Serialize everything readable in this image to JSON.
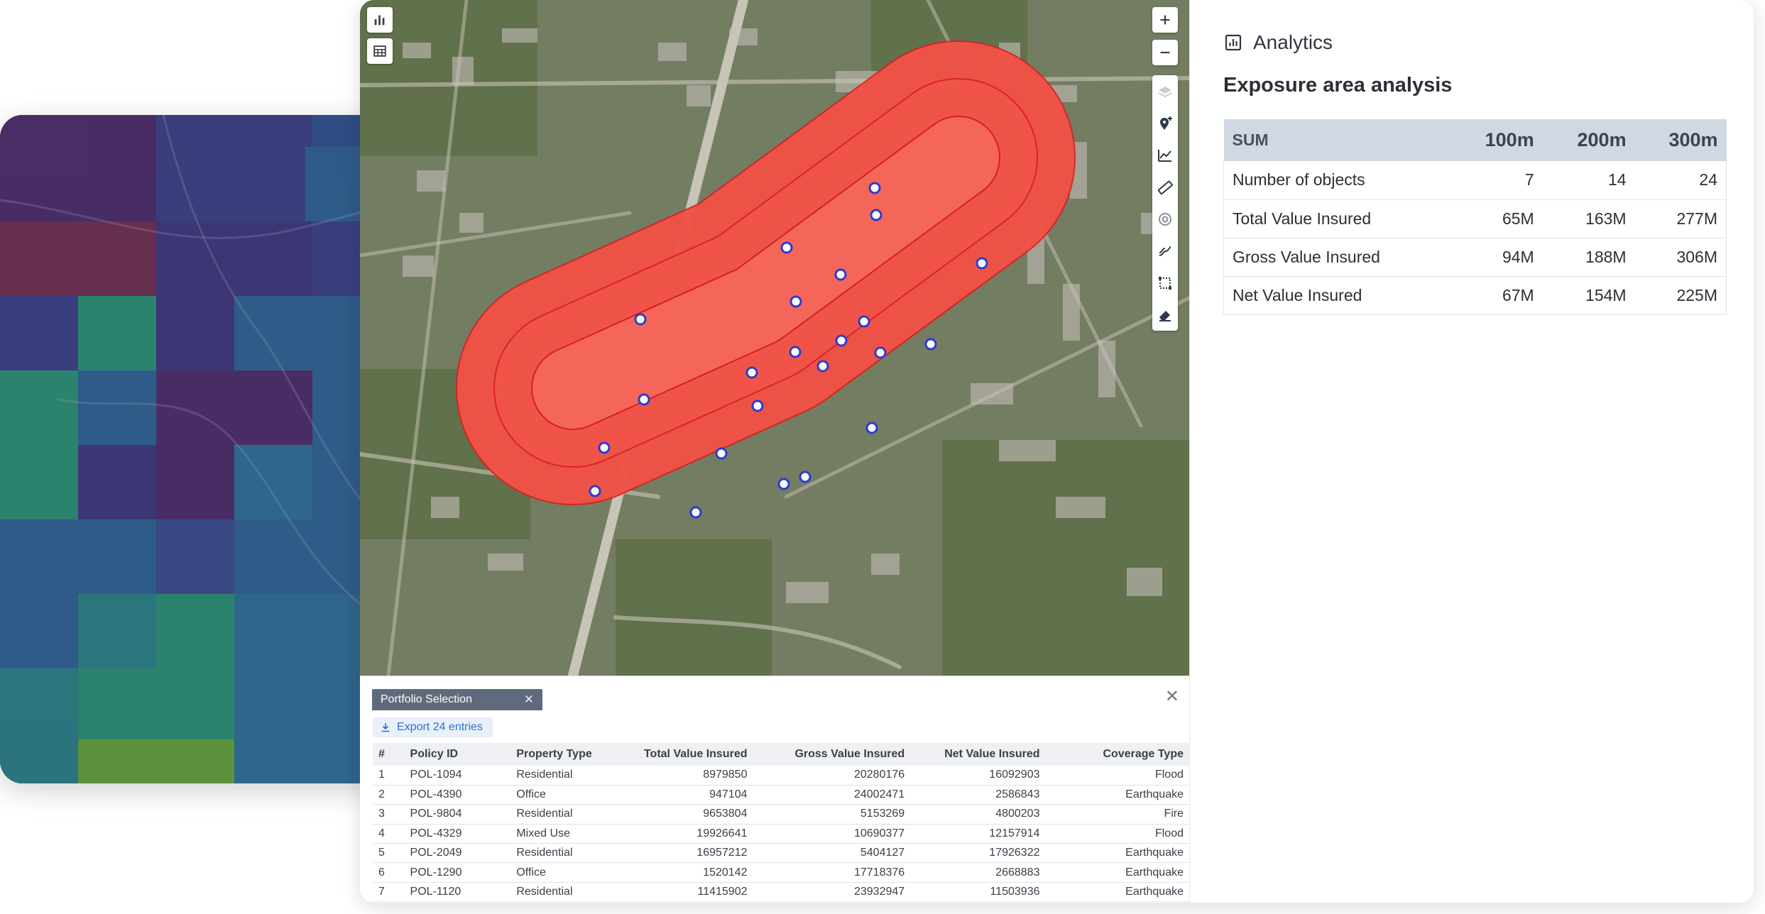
{
  "analytics": {
    "header": "Analytics",
    "title": "Exposure area analysis",
    "table": {
      "headers": [
        "SUM",
        "100m",
        "200m",
        "300m"
      ],
      "rows": [
        {
          "label": "Number of objects",
          "v100": "7",
          "v200": "14",
          "v300": "24"
        },
        {
          "label": "Total Value Insured",
          "v100": "65M",
          "v200": "163M",
          "v300": "277M"
        },
        {
          "label": "Gross Value Insured",
          "v100": "94M",
          "v200": "188M",
          "v300": "306M"
        },
        {
          "label": "Net Value Insured",
          "v100": "67M",
          "v200": "154M",
          "v300": "225M"
        }
      ]
    }
  },
  "panel": {
    "tab_label": "Portfolio Selection",
    "export_label": "Export 24 entries",
    "columns": [
      "#",
      "Policy ID",
      "Property Type",
      "Total Value Insured",
      "Gross Value Insured",
      "Net Value Insured",
      "Coverage Type"
    ],
    "rows": [
      {
        "n": "1",
        "id": "POL-1094",
        "type": "Residential",
        "tvi": "8979850",
        "gvi": "20280176",
        "nvi": "16092903",
        "cov": "Flood"
      },
      {
        "n": "2",
        "id": "POL-4390",
        "type": "Office",
        "tvi": "947104",
        "gvi": "24002471",
        "nvi": "2586843",
        "cov": "Earthquake"
      },
      {
        "n": "3",
        "id": "POL-9804",
        "type": "Residential",
        "tvi": "9653804",
        "gvi": "5153269",
        "nvi": "4800203",
        "cov": "Fire"
      },
      {
        "n": "4",
        "id": "POL-4329",
        "type": "Mixed Use",
        "tvi": "19926641",
        "gvi": "10690377",
        "nvi": "12157914",
        "cov": "Flood"
      },
      {
        "n": "5",
        "id": "POL-2049",
        "type": "Residential",
        "tvi": "16957212",
        "gvi": "5404127",
        "nvi": "17926322",
        "cov": "Earthquake"
      },
      {
        "n": "6",
        "id": "POL-1290",
        "type": "Office",
        "tvi": "1520142",
        "gvi": "17718376",
        "nvi": "2668883",
        "cov": "Earthquake"
      },
      {
        "n": "7",
        "id": "POL-1120",
        "type": "Residential",
        "tvi": "11415902",
        "gvi": "23932947",
        "nvi": "11503936",
        "cov": "Earthquake"
      }
    ]
  },
  "map_tools": {
    "left": [
      "bar-chart-icon",
      "table-icon"
    ],
    "zoom": [
      "zoom-in-icon",
      "zoom-out-icon"
    ],
    "column": [
      "layers-icon",
      "marker-add-icon",
      "line-chart-icon",
      "ruler-icon",
      "target-icon",
      "route-icon",
      "select-rect-icon",
      "eraser-icon"
    ]
  },
  "colors": {
    "buffer_fill": "#f0473f",
    "buffer_stroke": "#d81e1e",
    "marker": "#2d3bd1",
    "header_row": "#cfd8e3"
  }
}
